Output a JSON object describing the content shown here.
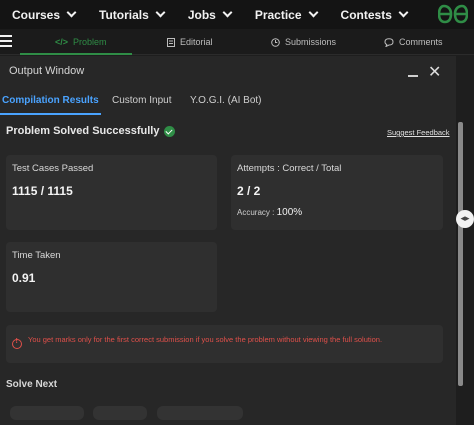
{
  "nav": {
    "items": [
      {
        "label": "Courses"
      },
      {
        "label": "Tutorials"
      },
      {
        "label": "Jobs"
      },
      {
        "label": "Practice"
      },
      {
        "label": "Contests"
      }
    ],
    "logo_icon": "gfg-logo",
    "brand_color": "#2f8d46"
  },
  "tabs": [
    {
      "label": "Problem",
      "icon": "code-icon",
      "active": true
    },
    {
      "label": "Editorial",
      "icon": "document-icon"
    },
    {
      "label": "Submissions",
      "icon": "clock-icon"
    },
    {
      "label": "Comments",
      "icon": "chat-icon"
    }
  ],
  "output_window": {
    "title": "Output Window",
    "subtabs": [
      {
        "label": "Compilation Results",
        "active": true
      },
      {
        "label": "Custom Input"
      },
      {
        "label": "Y.O.G.I. (AI Bot)"
      }
    ],
    "status": "Problem Solved Successfully",
    "feedback_link": "Suggest Feedback",
    "cards": {
      "test_cases": {
        "label": "Test Cases Passed",
        "value": "1115 / 1115"
      },
      "attempts": {
        "label": "Attempts : Correct / Total",
        "value": "2 / 2",
        "accuracy_label": "Accuracy :",
        "accuracy_value": "100%"
      },
      "time": {
        "label": "Time Taken",
        "value": "0.91"
      }
    },
    "warning": "You get marks only for the first correct submission if you solve the problem without viewing the full solution.",
    "solve_next": "Solve Next"
  }
}
